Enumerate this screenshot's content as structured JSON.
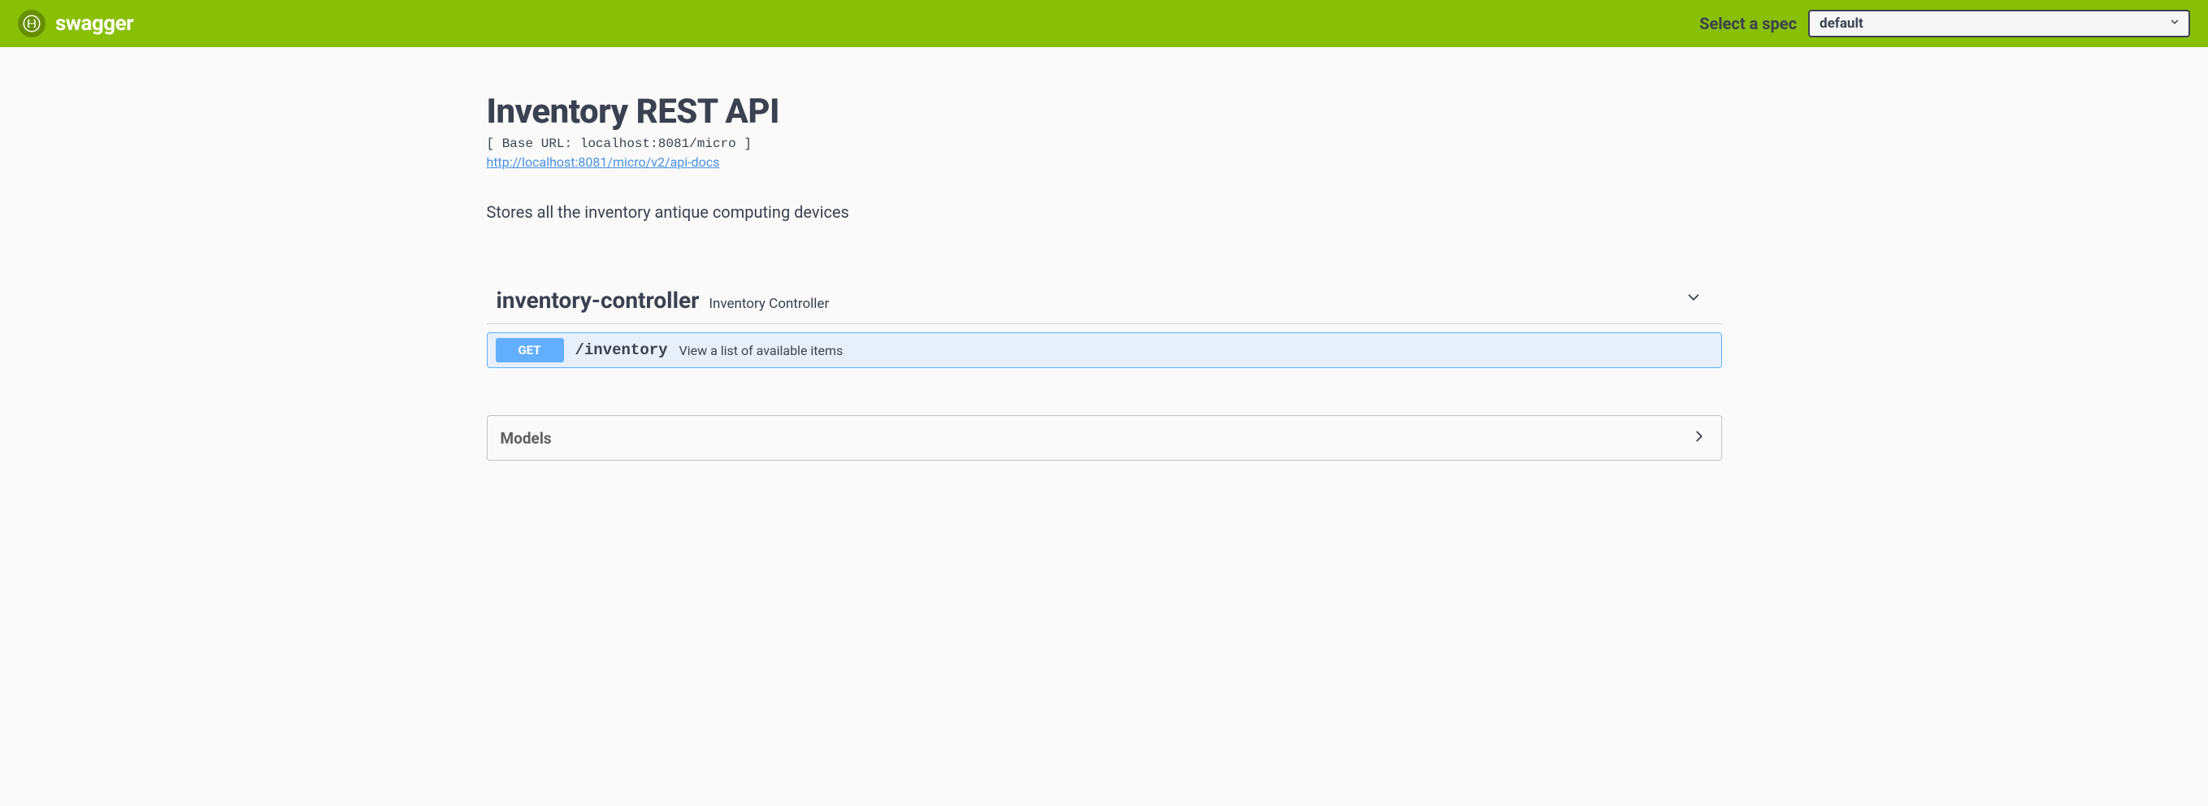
{
  "topbar": {
    "brand": "swagger",
    "spec_label": "Select a spec",
    "spec_selected": "default"
  },
  "info": {
    "title": "Inventory REST API",
    "base_url_display": "[ Base URL: localhost:8081/micro ]",
    "api_docs_url": "http://localhost:8081/micro/v2/api-docs",
    "description": "Stores all the inventory antique computing devices"
  },
  "tags": [
    {
      "name": "inventory-controller",
      "description": "Inventory Controller",
      "operations": [
        {
          "method": "GET",
          "path": "/inventory",
          "summary": "View a list of available items"
        }
      ]
    }
  ],
  "models": {
    "title": "Models"
  }
}
